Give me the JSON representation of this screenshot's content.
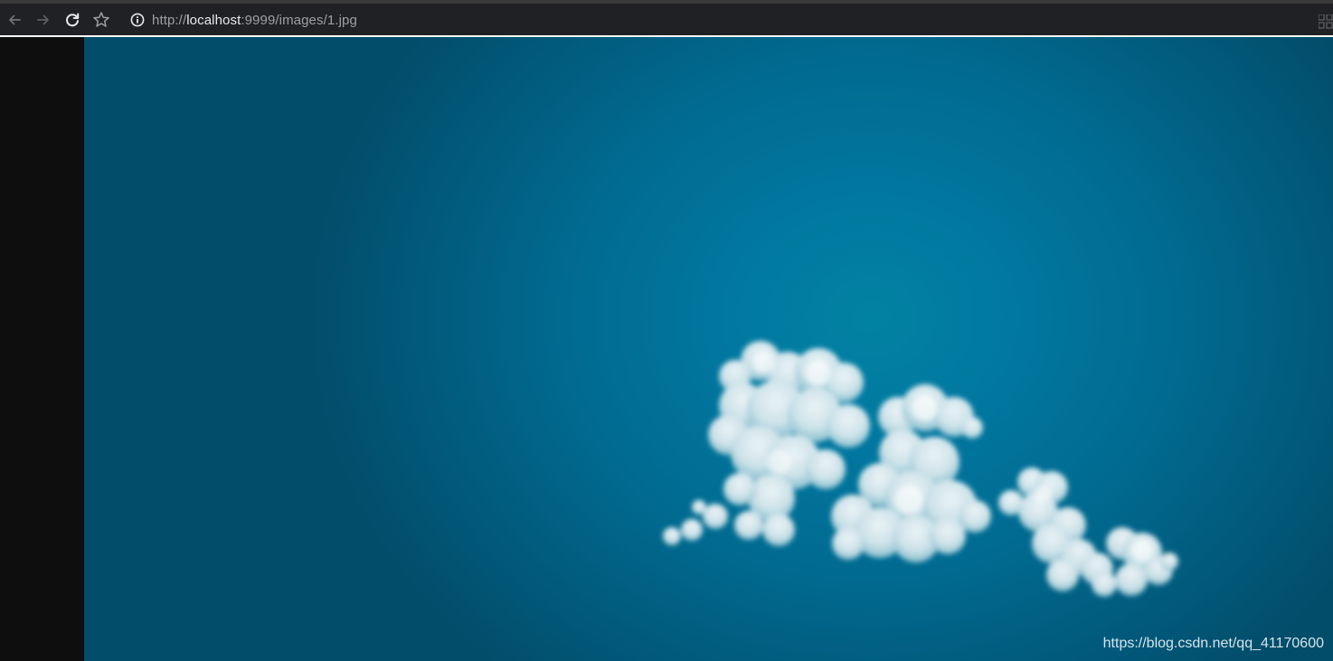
{
  "browser": {
    "url_scheme": "http://",
    "url_host": "localhost",
    "url_rest": ":9999/images/1.jpg"
  },
  "image": {
    "watermark": "https://blog.csdn.net/qq_41170600"
  },
  "colors": {
    "toolbar_bg": "#202124",
    "page_bg": "#0e0e0e",
    "sky_center": "#0282a3",
    "sky_edge": "#024d6a",
    "cloud": "#eef4f6"
  }
}
